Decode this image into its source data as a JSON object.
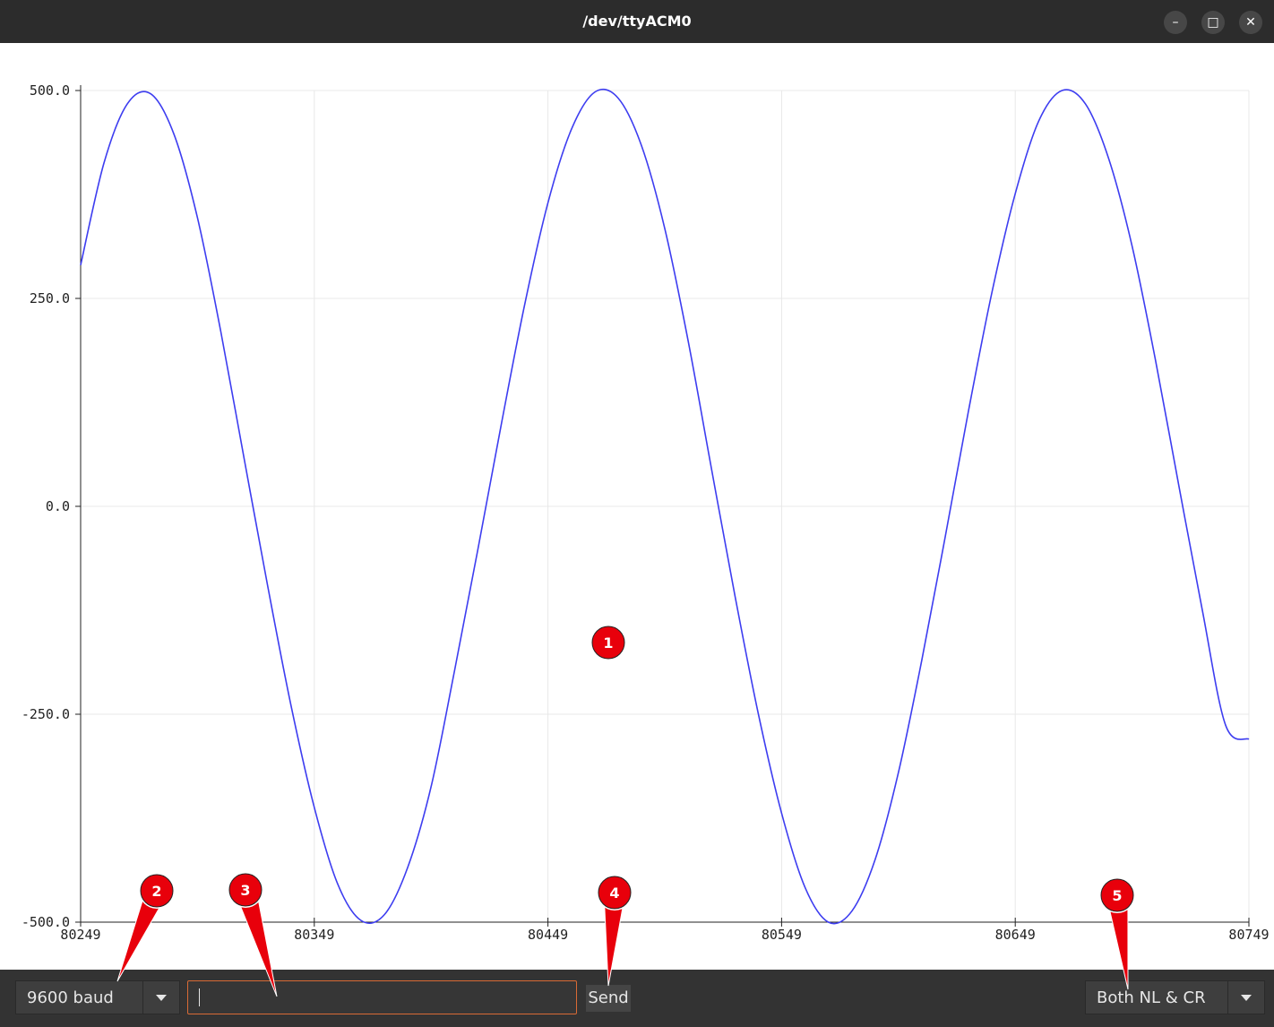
{
  "window": {
    "title": "/dev/ttyACM0",
    "minimize_icon": "minimize-icon",
    "maximize_icon": "maximize-icon",
    "close_icon": "close-icon"
  },
  "chart_data": {
    "type": "line",
    "title": "",
    "xlabel": "",
    "ylabel": "",
    "xlim": [
      80249,
      80749
    ],
    "ylim": [
      -500,
      500
    ],
    "x_ticks": [
      "80249",
      "80349",
      "80449",
      "80549",
      "80649",
      "80749"
    ],
    "y_ticks": [
      "500.0",
      "250.0",
      "0.0",
      "-250.0",
      "-500.0"
    ],
    "grid": true,
    "series": [
      {
        "color": "#3d3df0",
        "x": [
          80249,
          80259,
          80269,
          80279,
          80289,
          80299,
          80309,
          80319,
          80329,
          80339,
          80349,
          80359,
          80369,
          80379,
          80389,
          80399,
          80409,
          80419,
          80429,
          80439,
          80449,
          80459,
          80469,
          80479,
          80489,
          80499,
          80509,
          80519,
          80529,
          80539,
          80549,
          80559,
          80569,
          80579,
          80589,
          80599,
          80609,
          80619,
          80629,
          80639,
          80649,
          80659,
          80669,
          80679,
          80689,
          80699,
          80709,
          80719,
          80729,
          80739,
          80749
        ],
        "values": [
          290,
          413,
          484,
          496,
          447,
          347,
          210,
          57,
          -95,
          -239,
          -362,
          -454,
          -498,
          -491,
          -434,
          -337,
          -198,
          -52,
          98,
          242,
          365,
          453,
          498,
          491,
          434,
          334,
          199,
          45,
          -107,
          -249,
          -369,
          -458,
          -500,
          -487,
          -425,
          -320,
          -185,
          -37,
          115,
          257,
          376,
          463,
          500,
          484,
          418,
          313,
          176,
          25,
          -124,
          -263,
          -280
        ]
      }
    ]
  },
  "bottom": {
    "baud_value": "9600 baud",
    "message_input_value": "",
    "send_label": "Send",
    "line_ending_value": "Both NL & CR"
  },
  "callouts": [
    {
      "label": "1",
      "color": "#e8000b"
    },
    {
      "label": "2",
      "color": "#e8000b"
    },
    {
      "label": "3",
      "color": "#e8000b"
    },
    {
      "label": "4",
      "color": "#e8000b"
    },
    {
      "label": "5",
      "color": "#e8000b"
    }
  ]
}
